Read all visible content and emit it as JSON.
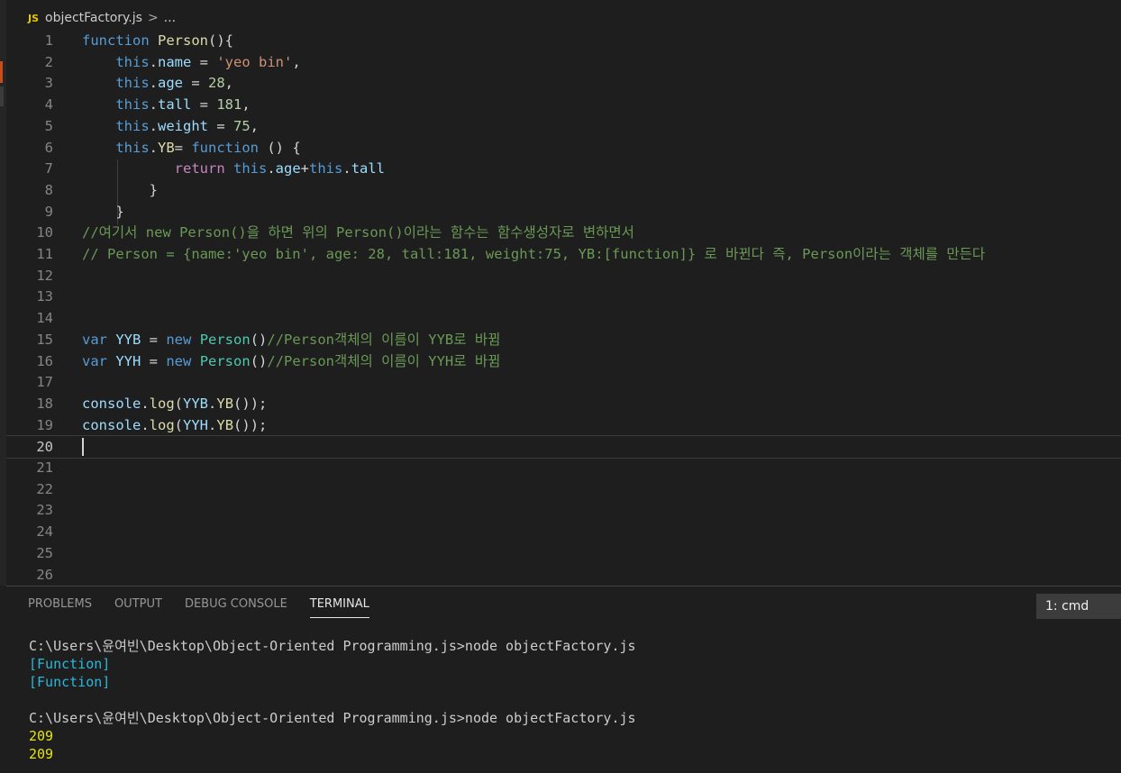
{
  "breadcrumb": {
    "icon": "JS",
    "file": "objectFactory.js",
    "sep": ">",
    "more": "..."
  },
  "editor": {
    "line_numbers": [
      "1",
      "2",
      "3",
      "4",
      "5",
      "6",
      "7",
      "8",
      "9",
      "10",
      "11",
      "12",
      "13",
      "14",
      "15",
      "16",
      "17",
      "18",
      "19",
      "20",
      "21",
      "22",
      "23",
      "24",
      "25",
      "26"
    ],
    "active_line": "20",
    "lines": [
      [
        {
          "t": "function",
          "c": "kw"
        },
        {
          "t": " "
        },
        {
          "t": "Person",
          "c": "fn"
        },
        {
          "t": "(){"
        }
      ],
      [
        {
          "t": "    "
        },
        {
          "t": "this",
          "c": "kw"
        },
        {
          "t": "."
        },
        {
          "t": "name",
          "c": "prop"
        },
        {
          "t": " = "
        },
        {
          "t": "'yeo bin'",
          "c": "str"
        },
        {
          "t": ","
        }
      ],
      [
        {
          "t": "    "
        },
        {
          "t": "this",
          "c": "kw"
        },
        {
          "t": "."
        },
        {
          "t": "age",
          "c": "prop"
        },
        {
          "t": " = "
        },
        {
          "t": "28",
          "c": "num"
        },
        {
          "t": ","
        }
      ],
      [
        {
          "t": "    "
        },
        {
          "t": "this",
          "c": "kw"
        },
        {
          "t": "."
        },
        {
          "t": "tall",
          "c": "prop"
        },
        {
          "t": " = "
        },
        {
          "t": "181",
          "c": "num"
        },
        {
          "t": ","
        }
      ],
      [
        {
          "t": "    "
        },
        {
          "t": "this",
          "c": "kw"
        },
        {
          "t": "."
        },
        {
          "t": "weight",
          "c": "prop"
        },
        {
          "t": " = "
        },
        {
          "t": "75",
          "c": "num"
        },
        {
          "t": ","
        }
      ],
      [
        {
          "t": "    "
        },
        {
          "t": "this",
          "c": "kw"
        },
        {
          "t": "."
        },
        {
          "t": "YB",
          "c": "fn"
        },
        {
          "t": "= "
        },
        {
          "t": "function",
          "c": "kw"
        },
        {
          "t": " () {"
        }
      ],
      [
        {
          "t": "           "
        },
        {
          "t": "return",
          "c": "ctl"
        },
        {
          "t": " "
        },
        {
          "t": "this",
          "c": "kw"
        },
        {
          "t": "."
        },
        {
          "t": "age",
          "c": "prop"
        },
        {
          "t": "+"
        },
        {
          "t": "this",
          "c": "kw"
        },
        {
          "t": "."
        },
        {
          "t": "tall",
          "c": "prop"
        }
      ],
      [
        {
          "t": "        }"
        }
      ],
      [
        {
          "t": "    }"
        }
      ],
      [
        {
          "t": "//여기서 new Person()을 하면 위의 Person()이라는 함수는 함수생성자로 변하면서",
          "c": "cmt"
        }
      ],
      [
        {
          "t": "// Person = {name:'yeo bin', age: 28, tall:181, weight:75, YB:[function]} 로 바뀐다 즉, Person이라는 객체를 만든다",
          "c": "cmt"
        }
      ],
      [],
      [],
      [],
      [
        {
          "t": "var",
          "c": "kw"
        },
        {
          "t": " "
        },
        {
          "t": "YYB",
          "c": "prop"
        },
        {
          "t": " = "
        },
        {
          "t": "new",
          "c": "kw"
        },
        {
          "t": " "
        },
        {
          "t": "Person",
          "c": "cls"
        },
        {
          "t": "()"
        },
        {
          "t": "//Person객체의 이름이 YYB로 바뀜",
          "c": "cmt"
        }
      ],
      [
        {
          "t": "var",
          "c": "kw"
        },
        {
          "t": " "
        },
        {
          "t": "YYH",
          "c": "prop"
        },
        {
          "t": " = "
        },
        {
          "t": "new",
          "c": "kw"
        },
        {
          "t": " "
        },
        {
          "t": "Person",
          "c": "cls"
        },
        {
          "t": "()"
        },
        {
          "t": "//Person객체의 이름이 YYH로 바뀜",
          "c": "cmt"
        }
      ],
      [],
      [
        {
          "t": "console",
          "c": "prop"
        },
        {
          "t": "."
        },
        {
          "t": "log",
          "c": "fn"
        },
        {
          "t": "("
        },
        {
          "t": "YYB",
          "c": "prop"
        },
        {
          "t": "."
        },
        {
          "t": "YB",
          "c": "fn"
        },
        {
          "t": "());"
        }
      ],
      [
        {
          "t": "console",
          "c": "prop"
        },
        {
          "t": "."
        },
        {
          "t": "log",
          "c": "fn"
        },
        {
          "t": "("
        },
        {
          "t": "YYH",
          "c": "prop"
        },
        {
          "t": "."
        },
        {
          "t": "YB",
          "c": "fn"
        },
        {
          "t": "());"
        }
      ],
      [],
      [],
      [],
      [],
      [],
      [],
      []
    ]
  },
  "panel": {
    "tabs": [
      {
        "label": "PROBLEMS",
        "active": false
      },
      {
        "label": "OUTPUT",
        "active": false
      },
      {
        "label": "DEBUG CONSOLE",
        "active": false
      },
      {
        "label": "TERMINAL",
        "active": true
      }
    ],
    "terminal_select": "1: cmd",
    "terminal_lines": [
      {
        "text": "C:\\Users\\윤여빈\\Desktop\\Object-Oriented Programming.js>node objectFactory.js",
        "color": "white"
      },
      {
        "text": "[Function]",
        "color": "cyan"
      },
      {
        "text": "[Function]",
        "color": "cyan"
      },
      {
        "text": "",
        "color": "white"
      },
      {
        "text": "C:\\Users\\윤여빈\\Desktop\\Object-Oriented Programming.js>node objectFactory.js",
        "color": "white"
      },
      {
        "text": "209",
        "color": "yellow"
      },
      {
        "text": "209",
        "color": "yellow"
      }
    ]
  }
}
